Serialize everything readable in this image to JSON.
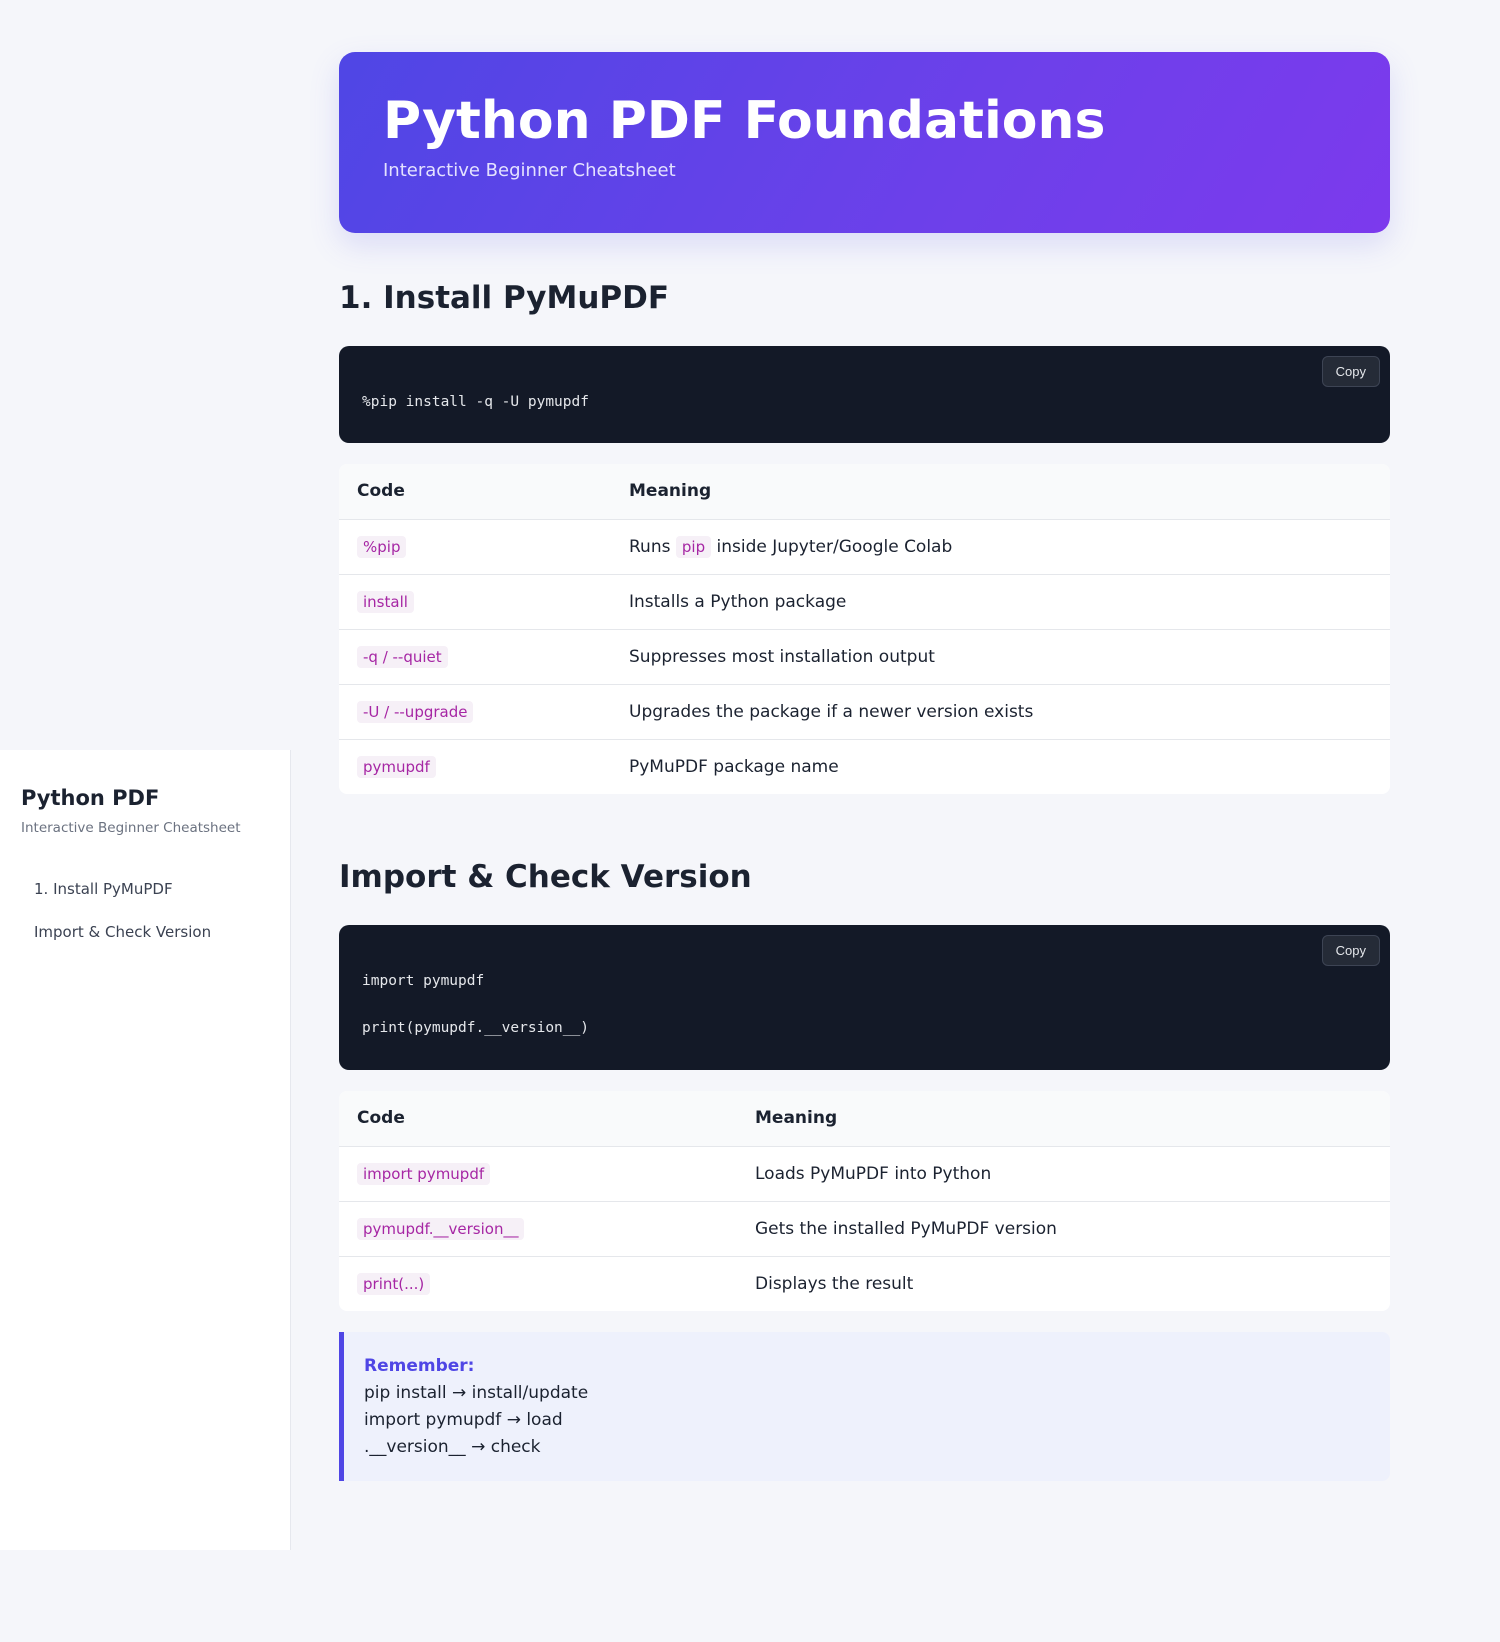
{
  "sidebar": {
    "title": "Python PDF",
    "subtitle": "Interactive Beginner Cheatsheet",
    "nav": [
      "1. Install PyMuPDF",
      "Import & Check Version"
    ]
  },
  "hero": {
    "title": "Python PDF Foundations",
    "subtitle": "Interactive Beginner Cheatsheet"
  },
  "sections": [
    {
      "heading": "1. Install PyMuPDF",
      "code_lines": [
        "%pip install -q -U pymupdf"
      ],
      "copy_label": "Copy",
      "table": {
        "headers": [
          "Code",
          "Meaning"
        ],
        "rows": [
          {
            "code": "%pip",
            "meaning_pre": "Runs",
            "meaning_chip": "pip",
            "meaning_post": "inside Jupyter/Google Colab"
          },
          {
            "code": "install",
            "meaning": "Installs a Python package"
          },
          {
            "code": "-q / --quiet",
            "meaning": "Suppresses most installation output"
          },
          {
            "code": "-U / --upgrade",
            "meaning": "Upgrades the package if a newer version exists"
          },
          {
            "code": "pymupdf",
            "meaning": "PyMuPDF package name"
          }
        ]
      }
    },
    {
      "heading": "Import & Check Version",
      "code_lines": [
        "import pymupdf",
        "print(pymupdf.__version__)"
      ],
      "copy_label": "Copy",
      "table": {
        "headers": [
          "Code",
          "Meaning"
        ],
        "rows": [
          {
            "code": "import pymupdf",
            "meaning": "Loads PyMuPDF into Python"
          },
          {
            "code": "pymupdf.__version__",
            "meaning": "Gets the installed PyMuPDF version"
          },
          {
            "code": "print(...)",
            "meaning": "Displays the result"
          }
        ]
      },
      "callout": {
        "title": "Remember:",
        "lines": [
          "pip install → install/update",
          "import pymupdf → load",
          ".__version__ → check"
        ]
      }
    }
  ],
  "colors": {
    "accent": "#4f46e5",
    "accent_end": "#7c3aed",
    "code_bg": "#131927",
    "chip_text": "#a626a4"
  }
}
